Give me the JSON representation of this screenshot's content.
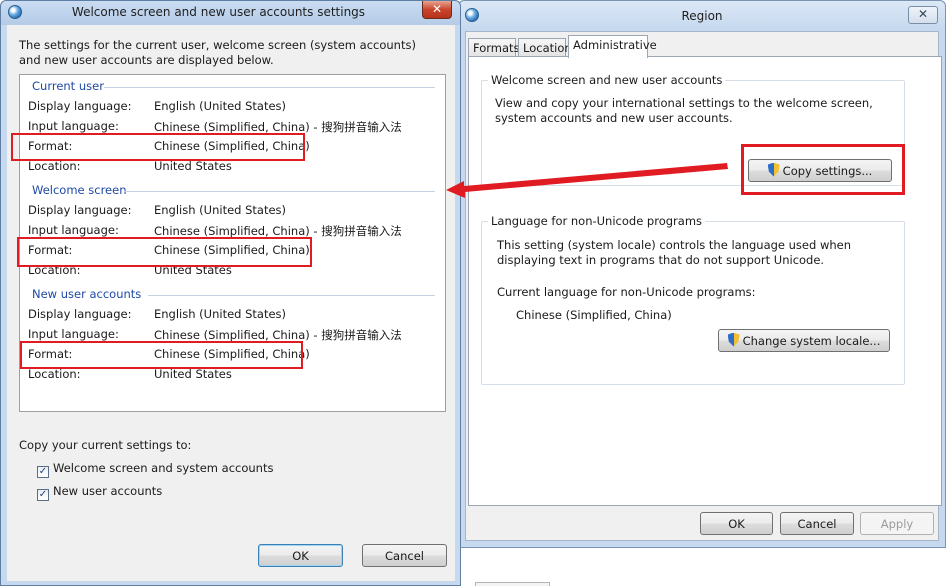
{
  "region": {
    "title": "Region",
    "close_glyph": "✕",
    "tabs": [
      {
        "label": "Formats"
      },
      {
        "label": "Location"
      },
      {
        "label": "Administrative"
      }
    ],
    "welcome_group": {
      "legend": "Welcome screen and new user accounts",
      "text": "View and copy your international settings to the welcome screen, system accounts and new user accounts.",
      "copy_button": "Copy settings..."
    },
    "nonunicode_group": {
      "legend": "Language for non-Unicode programs",
      "text": "This setting (system locale) controls the language used when displaying text in programs that do not support Unicode.",
      "current_label": "Current language for non-Unicode programs:",
      "current_value": "Chinese (Simplified, China)",
      "change_button": "Change system locale..."
    },
    "buttons": {
      "ok": "OK",
      "cancel": "Cancel",
      "apply": "Apply"
    }
  },
  "welcome_dialog": {
    "title": "Welcome screen and new user accounts settings",
    "close_glyph": "✕",
    "intro": "The settings for the current user, welcome screen (system accounts) and new user accounts are displayed below.",
    "sections": [
      {
        "heading": "Current user",
        "rows": [
          {
            "label": "Display language:",
            "value": "English (United States)"
          },
          {
            "label": "Input language:",
            "value": "Chinese (Simplified, China) - 搜狗拼音输入法"
          },
          {
            "label": "Format:",
            "value": "Chinese (Simplified, China)"
          },
          {
            "label": "Location:",
            "value": "United States"
          }
        ]
      },
      {
        "heading": "Welcome screen",
        "rows": [
          {
            "label": "Display language:",
            "value": "English (United States)"
          },
          {
            "label": "Input language:",
            "value": "Chinese (Simplified, China) - 搜狗拼音输入法"
          },
          {
            "label": "Format:",
            "value": "Chinese (Simplified, China)"
          },
          {
            "label": "Location:",
            "value": "United States"
          }
        ]
      },
      {
        "heading": "New user accounts",
        "rows": [
          {
            "label": "Display language:",
            "value": "English (United States)"
          },
          {
            "label": "Input language:",
            "value": "Chinese (Simplified, China) - 搜狗拼音输入法"
          },
          {
            "label": "Format:",
            "value": "Chinese (Simplified, China)"
          },
          {
            "label": "Location:",
            "value": "United States"
          }
        ]
      }
    ],
    "copy_label": "Copy your current settings to:",
    "checkboxes": [
      {
        "label": "Welcome screen and system accounts",
        "checked": true
      },
      {
        "label": "New user accounts",
        "checked": true
      }
    ],
    "check_glyph": "✓",
    "buttons": {
      "ok": "OK",
      "cancel": "Cancel"
    }
  },
  "annotation_colors": {
    "highlight": "#e11b22"
  }
}
